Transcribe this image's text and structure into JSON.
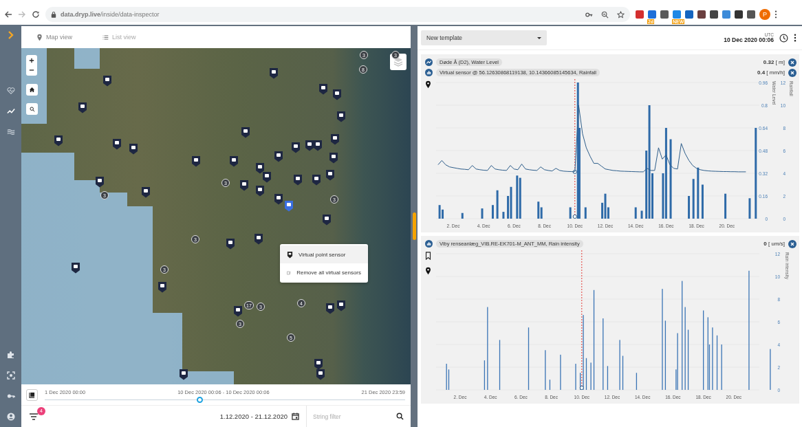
{
  "browser": {
    "url": "**data.dryp.live**/inside/data-inspector",
    "forward_disabled": true,
    "extensions": [
      {
        "color": "#d32f2f"
      },
      {
        "color": "#1e6fd9",
        "badge": "2d"
      },
      {
        "color": "#5a5a5a"
      },
      {
        "color": "#1e88e5",
        "badge": "NEW"
      },
      {
        "color": "#1565c0"
      },
      {
        "color": "#6a3f3f"
      },
      {
        "color": "#444444"
      },
      {
        "color": "#3d8bd9"
      },
      {
        "color": "#333333"
      },
      {
        "color": "#555555"
      }
    ],
    "profile_initial": "P"
  },
  "map_panel": {
    "tabs": [
      {
        "label": "Map view",
        "selected": true
      },
      {
        "label": "List view",
        "selected": false
      }
    ],
    "clusters": [
      "3",
      "3",
      "8",
      "3",
      "3",
      "3",
      "3",
      "3",
      "17",
      "3",
      "4",
      "3",
      "5"
    ],
    "context_menu": [
      "Virtual point sensor",
      "Remove all virtual sensors"
    ]
  },
  "timeline": {
    "start": "1 Dec 2020 00:00",
    "range": "10 Dec 2020 00:06 - 10 Dec 2020 00:06",
    "end": "21 Dec 2020 23:59",
    "level": 0.43
  },
  "filter_bar": {
    "filter_count": "4",
    "date_range": "1.12.2020 - 21.12.2020",
    "search_placeholder": "String filter"
  },
  "template": {
    "value": "New template",
    "timezone": "UTC",
    "time": "10 Dec 2020 00:06"
  },
  "charts": [
    {
      "kind": "line_and_bars",
      "series": [
        {
          "kind": "line",
          "value": "**0.32** [ m]"
        },
        {
          "kind": "bars",
          "label": "Virtual sensor @ 56.12630868119138, 10.14366085145634, Rainfall",
          "value": "**0.4** [ mm/h]"
        }
      ],
      "right_ticks": [
        "12",
        "10",
        "8",
        "6",
        "4",
        "2",
        "0"
      ],
      "right_title": "Rainfall",
      "chart_data": {
        "type": "line",
        "ylabel": "Water Level",
        "ylim": [
          0,
          0.96
        ],
        "yticks": [
          0,
          0.16,
          0.32,
          0.48,
          0.64,
          0.8,
          0.96
        ],
        "categories": [
          null,
          null,
          null,
          null,
          "2. Dec",
          null,
          null,
          null,
          null,
          null,
          null,
          null,
          "4. Dec",
          null,
          null,
          null,
          null,
          null,
          null,
          null,
          "6. Dec",
          null,
          null,
          null,
          null,
          null,
          null,
          null,
          "8. Dec",
          null,
          null,
          null,
          null,
          null,
          null,
          null,
          "10. Dec",
          null,
          null,
          null,
          null,
          null,
          null,
          null,
          "12. Dec",
          null,
          null,
          null,
          null,
          null,
          null,
          null,
          "14. Dec",
          null,
          null,
          null,
          null,
          null,
          null,
          null,
          "16. Dec",
          null,
          null,
          null,
          null,
          null,
          null,
          null,
          "18. Dec",
          null,
          null,
          null,
          null,
          null,
          null,
          null,
          "20. Dec",
          null,
          null,
          null,
          null,
          null
        ],
        "series": [
          {
            "name": "Døde Å (D2), Water Level",
            "color": "#2d5d8a",
            "values": [
              0.38,
              0.41,
              0.38,
              0.365,
              0.36,
              0.355,
              0.35,
              0.348,
              0.345,
              0.375,
              0.35,
              0.345,
              0.342,
              0.34,
              0.375,
              0.35,
              0.345,
              0.342,
              0.34,
              0.375,
              0.35,
              0.345,
              0.385,
              0.35,
              0.345,
              0.342,
              0.34,
              0.365,
              0.345,
              0.34,
              0.336,
              0.355,
              0.34,
              0.335,
              0.333,
              0.332,
              0.33,
              0.8,
              0.6,
              0.5,
              0.44,
              0.39,
              0.39,
              0.37,
              0.35,
              0.345,
              0.34,
              0.338,
              0.335,
              0.334,
              0.333,
              0.332,
              0.331,
              0.33,
              0.33,
              0.355,
              0.34,
              0.34,
              0.5,
              0.42,
              0.45,
              0.38,
              0.355,
              0.35,
              0.53,
              0.46,
              0.41,
              0.375,
              0.355,
              0.345,
              0.34,
              0.337,
              0.335,
              0.334,
              0.333,
              0.332,
              0.332,
              0.331,
              0.331,
              0.33,
              0.33,
              0.33
            ]
          }
        ]
      }
    },
    {
      "kind": "bars",
      "series": [
        {
          "kind": "bars",
          "label": "Viby renseanlæg_VIB.RE-EK701-M_ANT_MM, Rain intensity",
          "value": "**0** [ um/s]"
        }
      ],
      "right_ticks": [
        "12",
        "10",
        "8",
        "6",
        "4",
        "2",
        "0"
      ],
      "right_title": "Rain intensity",
      "x_labels": [
        "2. Dec",
        "4. Dec",
        "6. Dec",
        "8. Dec",
        "10. Dec",
        "12. Dec",
        "14. Dec",
        "16. Dec",
        "18. Dec",
        "20. Dec"
      ]
    }
  ]
}
